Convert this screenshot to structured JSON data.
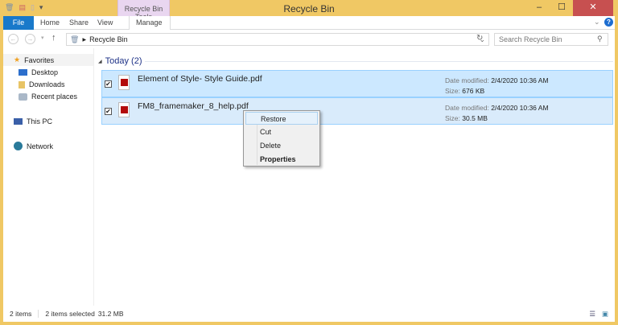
{
  "window": {
    "title": "Recycle Bin",
    "minimize": "–",
    "maximize": "☐",
    "close": "✕"
  },
  "ribbon": {
    "context_group": "Recycle Bin Tools",
    "tabs": [
      "File",
      "Home",
      "Share",
      "View",
      "Manage"
    ]
  },
  "address": {
    "path": "Recycle Bin",
    "search_placeholder": "Search Recycle Bin"
  },
  "nav": {
    "favorites": "Favorites",
    "items": [
      "Desktop",
      "Downloads",
      "Recent places"
    ],
    "this_pc": "This PC",
    "network": "Network"
  },
  "group": {
    "label": "Today (2)"
  },
  "files": [
    {
      "name": "Element of Style- Style Guide.pdf",
      "date_label": "Date modified:",
      "date": "2/4/2020 10:36 AM",
      "size_label": "Size:",
      "size": "676 KB"
    },
    {
      "name": "FM8_framemaker_8_help.pdf",
      "date_label": "Date modified:",
      "date": "2/4/2020 10:36 AM",
      "size_label": "Size:",
      "size": "30.5 MB"
    }
  ],
  "context_menu": [
    "Restore",
    "Cut",
    "Delete",
    "Properties"
  ],
  "status": {
    "items": "2 items",
    "selected": "2 items selected",
    "size": "31.2 MB"
  }
}
